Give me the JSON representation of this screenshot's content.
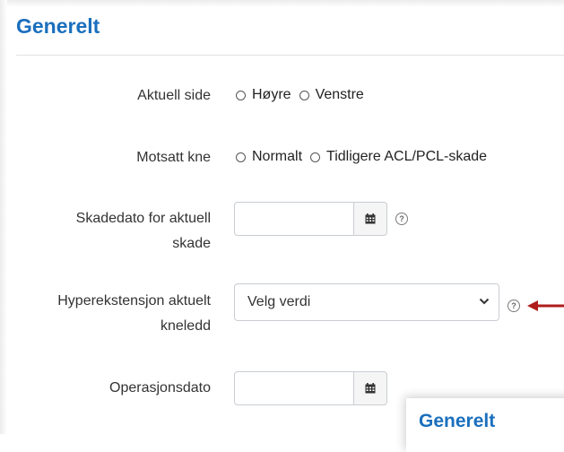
{
  "section": {
    "title": "Generelt"
  },
  "fields": {
    "side": {
      "label": "Aktuell side",
      "options": [
        "Høyre",
        "Venstre"
      ]
    },
    "other_knee": {
      "label": "Motsatt kne",
      "options": [
        "Normalt",
        "Tidligere ACL/PCL-skade"
      ]
    },
    "injury_date": {
      "label_line1": "Skadedato for aktuell",
      "label_line2": "skade",
      "value": ""
    },
    "hyperextension": {
      "label_line1": "Hyperekstensjon aktuelt",
      "label_line2": "kneledd",
      "selected": "Velg verdi"
    },
    "operation_date": {
      "label": "Operasjonsdato",
      "value": ""
    }
  },
  "help_icon_glyph": "?",
  "overlay": {
    "title": "Generelt"
  },
  "colors": {
    "accent": "#1a6fbd",
    "arrow": "#b01c1c"
  },
  "icons": [
    "calendar-icon",
    "help-icon",
    "chevron-down-icon",
    "arrow-left-icon",
    "radio-icon"
  ]
}
